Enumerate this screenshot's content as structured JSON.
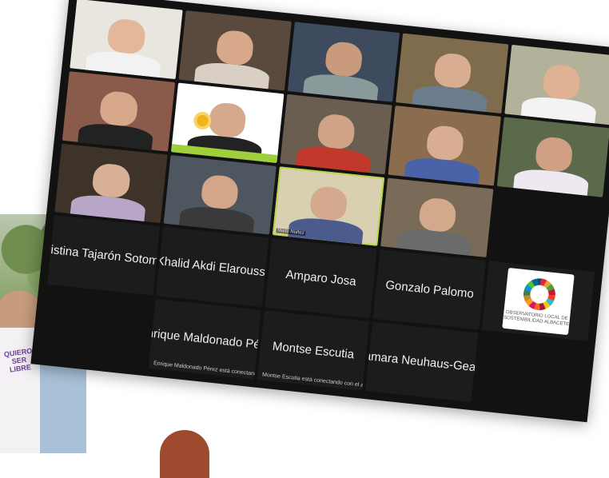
{
  "participants": [
    {
      "name": "",
      "skin": "#e2b79a",
      "bg": "#e9e6e0",
      "shirt": "#f2f2f2"
    },
    {
      "name": "",
      "skin": "#d7a98a",
      "bg": "#5a4a3d",
      "shirt": "#d9cfc4"
    },
    {
      "name": "",
      "skin": "#c99a7c",
      "bg": "#3e4a5e",
      "shirt": "#8a9a9a"
    },
    {
      "name": "",
      "skin": "#d9ad8f",
      "bg": "#7f6c4c",
      "shirt": "#6b7c8c"
    },
    {
      "name": "",
      "skin": "#dfb293",
      "bg": "#b2b19a",
      "shirt": "#f3f3f3"
    },
    {
      "name": "",
      "skin": "#d7a88a",
      "bg": "#8a5a4a",
      "shirt": "#222222"
    },
    {
      "name": "",
      "skin": "#d6a98c",
      "bg": "#ffffff",
      "shirt": "#222222",
      "logo": "SUN"
    },
    {
      "name": "",
      "skin": "#d1a386",
      "bg": "#6a5e51",
      "shirt": "#c0392b"
    },
    {
      "name": "",
      "skin": "#d9ad91",
      "bg": "#8a6c4e",
      "shirt": "#4a63a8"
    },
    {
      "name": "",
      "skin": "#cfa084",
      "bg": "#5b6a4a",
      "shirt": "#f0e8f0"
    },
    {
      "name": "",
      "skin": "#d8b095",
      "bg": "#3d3328",
      "shirt": "#b8a6c8"
    },
    {
      "name": "",
      "skin": "#d3a589",
      "bg": "#4e5660",
      "shirt": "#3a3a3a"
    },
    {
      "name": "",
      "skin": "#d5a98d",
      "bg": "#d8d0b0",
      "shirt": "#4b5b8b",
      "active": true,
      "label": "Maite Núñez"
    },
    {
      "name": "Gonzalo Palomo",
      "tile": "name"
    },
    {
      "name": "",
      "skin": "#d3a98c",
      "bg": "#7a6a58",
      "shirt": "#6b6b6b"
    },
    {
      "name": "Khalid Akdi Elaroussi",
      "tile": "name"
    },
    {
      "name": "Amparo Josa",
      "tile": "name"
    },
    {
      "name": "",
      "tile": "logo"
    },
    {
      "name": "Cristina Tajarón Sotom...",
      "tile": "name"
    },
    {
      "name": "Enrique Maldonado Pé...",
      "tile": "name",
      "status": "Enrique Maldonado Pérez está conectando con el audio ..."
    },
    {
      "name": "Montse Escutia",
      "tile": "name",
      "status": "Montse Escutia está conectando con el audio ..."
    },
    {
      "name": "Tamara Neuhaus-Gea...",
      "tile": "name"
    }
  ],
  "labels": {
    "sun_logo_caption": "SUN",
    "observatorio_caption": "OBSERVATORIO LOCAL DE SOSTENIBILIDAD ALBACETE",
    "tshirt_text": "QUIERO SER LIBRE"
  },
  "colors": {
    "active_border": "#b9d64a",
    "window_bg": "#121212",
    "name_tile_bg": "#1c1c1c"
  }
}
